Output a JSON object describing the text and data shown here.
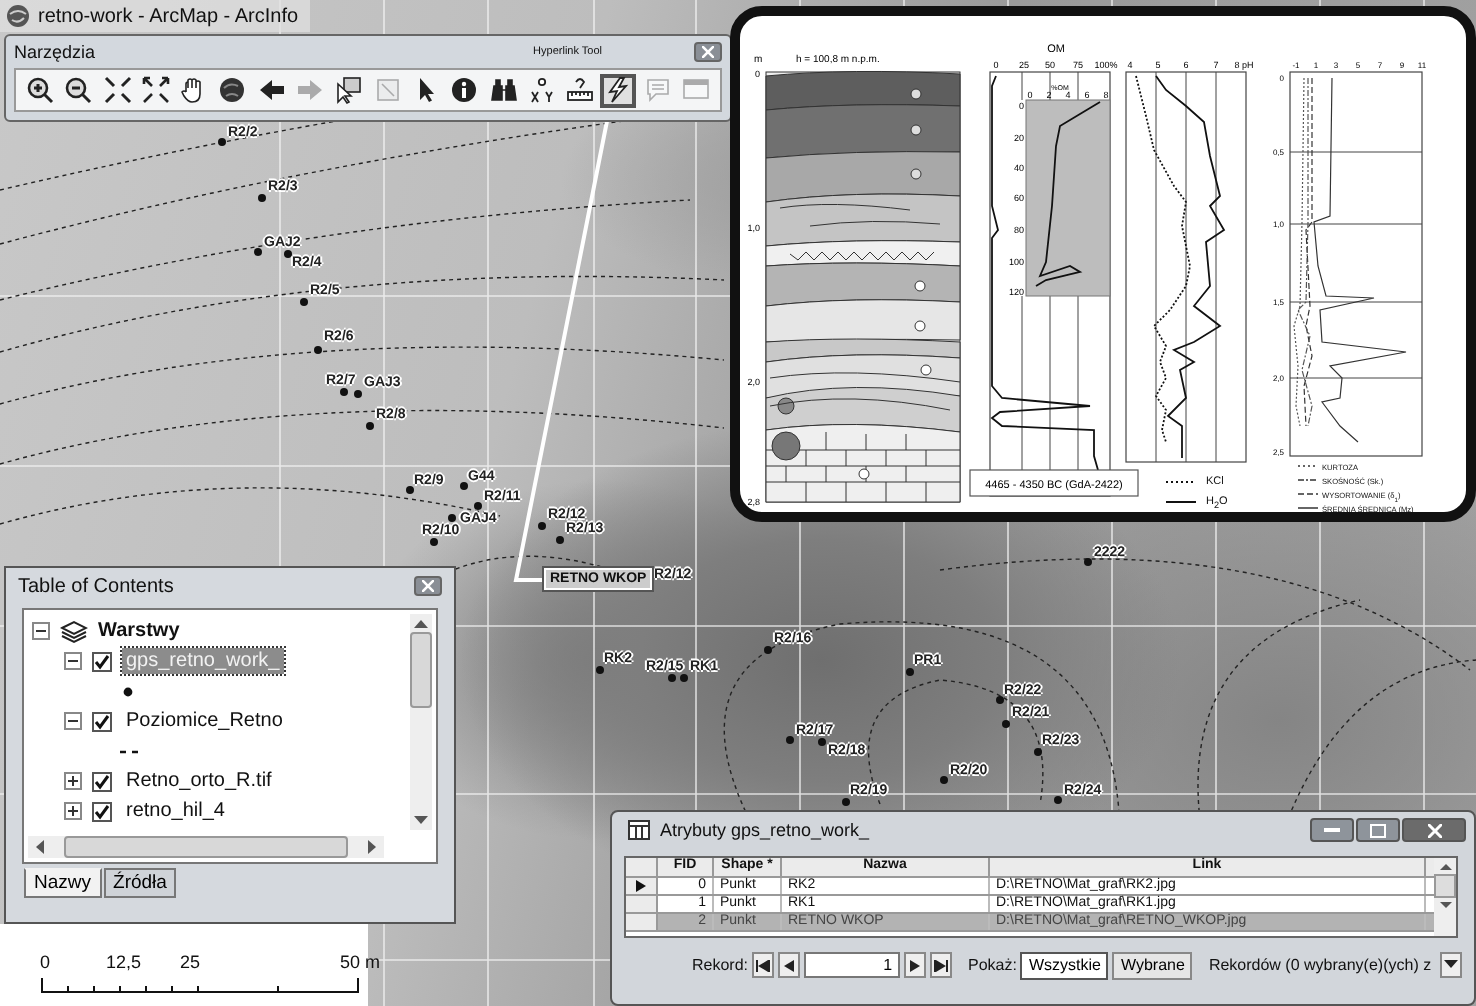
{
  "window": {
    "title": "retno-work - ArcMap - ArcInfo"
  },
  "toolbar": {
    "title": "Narzędzia",
    "tooltip": "Hyperlink Tool",
    "tools": [
      {
        "selected": false,
        "disabled": false
      },
      {
        "selected": false,
        "disabled": false
      },
      {
        "selected": false,
        "disabled": false
      },
      {
        "selected": false,
        "disabled": false
      },
      {
        "selected": false,
        "disabled": false
      },
      {
        "selected": false,
        "disabled": false
      },
      {
        "selected": false,
        "disabled": false
      },
      {
        "selected": false,
        "disabled": true
      },
      {
        "selected": false,
        "disabled": false
      },
      {
        "selected": false,
        "disabled": true
      },
      {
        "selected": false,
        "disabled": false
      },
      {
        "selected": false,
        "disabled": false
      },
      {
        "selected": false,
        "disabled": false
      },
      {
        "selected": false,
        "disabled": false
      },
      {
        "selected": false,
        "disabled": false
      },
      {
        "selected": true,
        "disabled": false
      },
      {
        "selected": false,
        "disabled": true
      },
      {
        "selected": false,
        "disabled": true
      }
    ]
  },
  "map": {
    "points": [
      {
        "label": "R2/2"
      },
      {
        "label": "R2/3"
      },
      {
        "label": "GAJ2"
      },
      {
        "label": "R2/4"
      },
      {
        "label": "R2/5"
      },
      {
        "label": "R2/6"
      },
      {
        "label": "R2/7"
      },
      {
        "label": "GAJ3"
      },
      {
        "label": "R2/8"
      },
      {
        "label": "R2/9"
      },
      {
        "label": "G44"
      },
      {
        "label": "R2/11"
      },
      {
        "label": "GAJ4"
      },
      {
        "label": "R2/10"
      },
      {
        "label": "R2/12"
      },
      {
        "label": "R2/13"
      },
      {
        "label": "R2/12"
      },
      {
        "label": "2222"
      },
      {
        "label": "R2/16"
      },
      {
        "label": "RK2"
      },
      {
        "label": "R2/15"
      },
      {
        "label": "RK1"
      },
      {
        "label": "PR1"
      },
      {
        "label": "R2/22"
      },
      {
        "label": "R2/21"
      },
      {
        "label": "R2/23"
      },
      {
        "label": "R2/17"
      },
      {
        "label": "R2/18"
      },
      {
        "label": "R2/20"
      },
      {
        "label": "R2/19"
      },
      {
        "label": "R2/24"
      }
    ],
    "callout": {
      "label": "RETNO WKOP"
    }
  },
  "hyperlink_popup": {
    "profile": {
      "unit": "m",
      "elevation": "h = 100,8 m  n.p.m.",
      "depth_ticks": [
        "0",
        "1,0",
        "2,0",
        "2,8"
      ],
      "date_label": "4465 - 4350 BC (GdA-2422)"
    },
    "organic_matter": {
      "title": "OM",
      "ticks": [
        "0",
        "25",
        "50",
        "75",
        "100%"
      ],
      "inset": {
        "title": "%OM",
        "x_ticks": [
          "0",
          "2",
          "4",
          "6",
          "8"
        ],
        "y_ticks": [
          "0",
          "20",
          "40",
          "60",
          "80",
          "100",
          "120"
        ]
      }
    },
    "ph": {
      "ticks": [
        "4",
        "5",
        "6",
        "7",
        "8 pH"
      ],
      "legend": [
        {
          "label": "KCl",
          "kind": "dotted"
        },
        {
          "label": "H$_{2}$O",
          "kind": "solid"
        }
      ]
    },
    "grain_size": {
      "x_ticks": [
        "-1",
        "1",
        "3",
        "5",
        "7",
        "9",
        "11"
      ],
      "depth_ticks": [
        "0",
        "0,5",
        "1,0",
        "1,5",
        "2,0",
        "2,5"
      ],
      "legend": [
        {
          "label": "KURTOZA",
          "kind": "dotted"
        },
        {
          "label": "SKOŚNOŚĆ (Sk.)",
          "kind": "dashdot"
        },
        {
          "label": "WYSORTOWANIE (δ$_{1}$)",
          "kind": "dashed"
        },
        {
          "label": "ŚREDNIA ŚREDNICA (Mz)",
          "kind": "solid"
        }
      ]
    }
  },
  "table_of_contents": {
    "title": "Table of Contents",
    "root": {
      "label": "Warstwy",
      "expanded": true,
      "children": [
        {
          "label": "gps_retno_work_",
          "kind": "point",
          "checked": true,
          "expanded": true,
          "selected": true
        },
        {
          "label": "Poziomice_Retno",
          "kind": "line",
          "checked": true,
          "expanded": true,
          "selected": false
        },
        {
          "label": "Retno_orto_R.tif",
          "checked": true,
          "expanded": false,
          "selected": false
        },
        {
          "label": "retno_hil_4",
          "checked": true,
          "expanded": false,
          "selected": false
        }
      ]
    },
    "tabs": [
      {
        "label": "Nazwy",
        "selected": true
      },
      {
        "label": "Źródła",
        "selected": false
      }
    ]
  },
  "scale_bar": {
    "labels": [
      "0",
      "12,5",
      "25",
      "50 m"
    ]
  },
  "attribute_table": {
    "title": "Atrybuty gps_retno_work_",
    "columns": [
      "FID",
      "Shape *",
      "Nazwa",
      "Link"
    ],
    "rows": [
      {
        "cells": [
          "0",
          "Punkt",
          "RK2",
          "D:\\RETNO\\Mat_graf\\RK2.jpg"
        ],
        "current": true,
        "selected": false
      },
      {
        "cells": [
          "1",
          "Punkt",
          "RK1",
          "D:\\RETNO\\Mat_graf\\RK1.jpg"
        ],
        "current": false,
        "selected": false
      },
      {
        "cells": [
          "2",
          "Punkt",
          "RETNO WKOP",
          "D:\\RETNO\\Mat_graf\\RETNO_WKOP.jpg"
        ],
        "current": false,
        "selected": true
      }
    ],
    "navigation": {
      "label": "Rekord:",
      "value": "1",
      "show_label": "Pokaż:",
      "buttons": [
        {
          "label": "Wszystkie",
          "selected": true
        },
        {
          "label": "Wybrane",
          "selected": false
        }
      ],
      "count": "Rekordów (0 wybrany(e)(ych) z"
    }
  }
}
